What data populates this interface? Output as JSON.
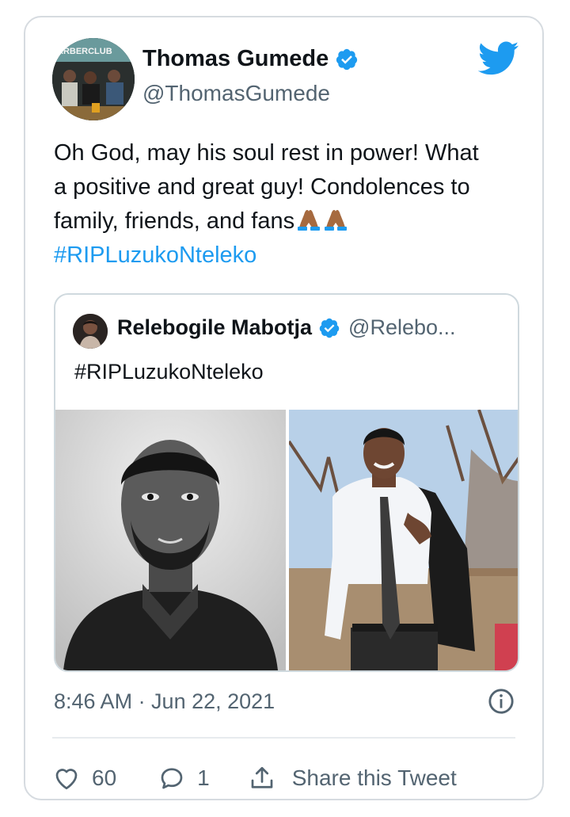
{
  "tweet": {
    "author_name": "Thomas Gumede",
    "author_handle": "@ThomasGumede",
    "avatar_text": "ARBERCLUB",
    "text_line1": "Oh God, may his soul rest in power! What",
    "text_line2": "a positive and great guy! Condolences to",
    "text_line3": "family, friends, and fans",
    "hashtag": "#RIPLuzukoNteleko",
    "timestamp": "8:46 AM · Jun 22, 2021"
  },
  "quoted": {
    "author_name": "Relebogile Mabotja",
    "author_handle": "@Relebo...",
    "text": "#RIPLuzukoNteleko"
  },
  "actions": {
    "likes": "60",
    "replies": "1",
    "share_label": "Share this Tweet"
  },
  "colors": {
    "accent": "#1d9bf0",
    "text": "#0f1419",
    "muted": "#536471",
    "border": "#d6dbe0"
  },
  "icons": {
    "brand": "twitter-bird-icon",
    "verified": "verified-badge-icon",
    "like": "heart-icon",
    "reply": "reply-icon",
    "share": "share-icon",
    "info": "info-icon",
    "emoji": "folded-hands-emoji-icon"
  }
}
